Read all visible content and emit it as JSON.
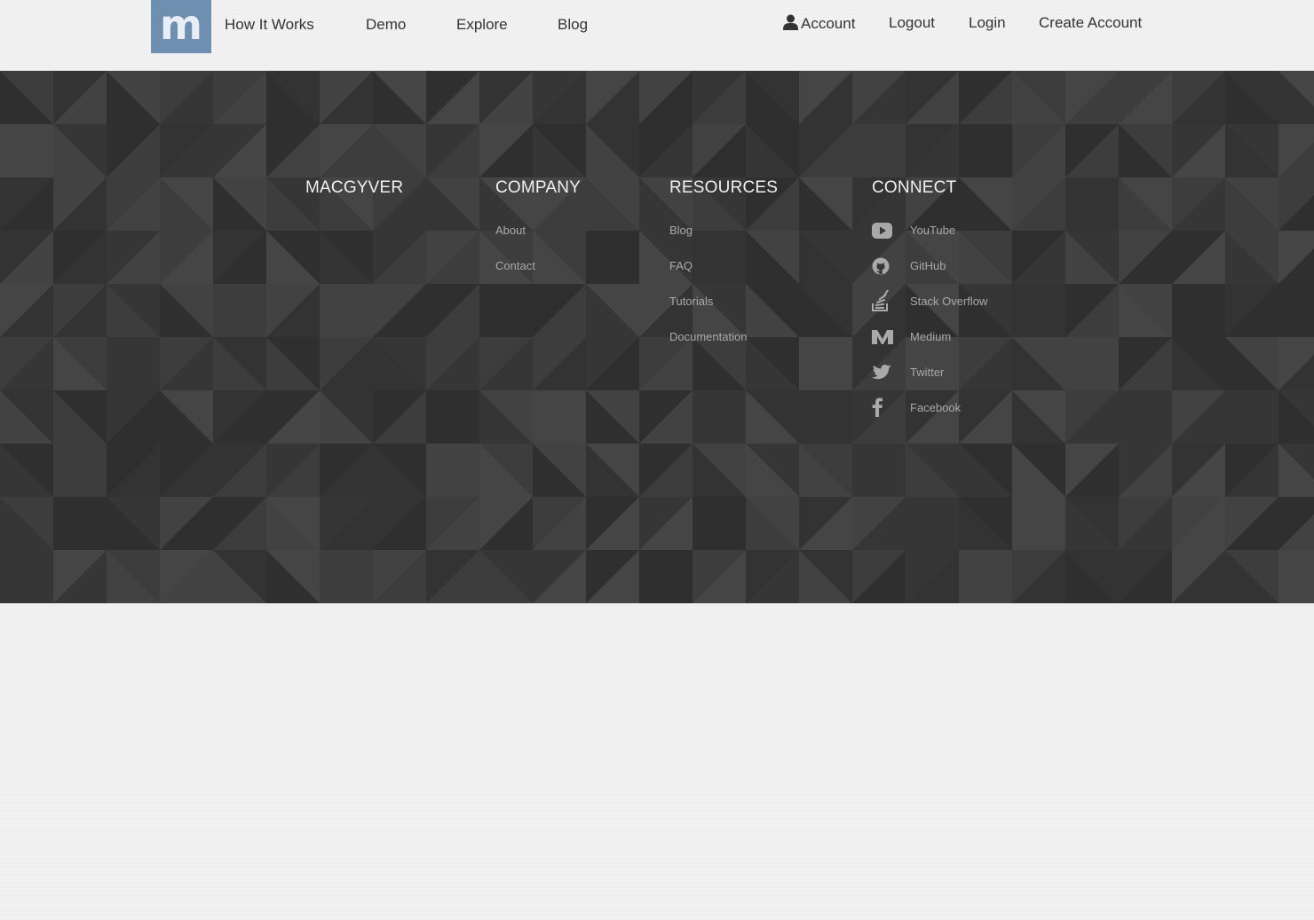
{
  "nav": {
    "logo_letter": "m",
    "left_links": [
      "How It Works",
      "Demo",
      "Explore",
      "Blog"
    ],
    "account_label": "Account",
    "account_icon": "user-icon",
    "logout_label": "Logout",
    "login_label": "Login",
    "create_account_label": "Create Account",
    "logo_color": "#6f8fb0"
  },
  "footer": {
    "columns": {
      "macgyver": {
        "title": "MACGYVER"
      },
      "company": {
        "title": "COMPANY",
        "links": [
          "About",
          "Contact"
        ]
      },
      "resources": {
        "title": "RESOURCES",
        "links": [
          "Blog",
          "FAQ",
          "Tutorials",
          "Documentation"
        ]
      },
      "connect": {
        "title": "CONNECT",
        "links": [
          {
            "label": "YouTube",
            "icon": "youtube-icon"
          },
          {
            "label": "GitHub",
            "icon": "github-icon"
          },
          {
            "label": "Stack Overflow",
            "icon": "stack-overflow-icon"
          },
          {
            "label": "Medium",
            "icon": "medium-icon"
          },
          {
            "label": "Twitter",
            "icon": "twitter-icon"
          },
          {
            "label": "Facebook",
            "icon": "facebook-icon"
          }
        ]
      }
    },
    "background_color": "#383838",
    "title_color": "#f0f0f0",
    "link_color": "#a9a9a9"
  }
}
